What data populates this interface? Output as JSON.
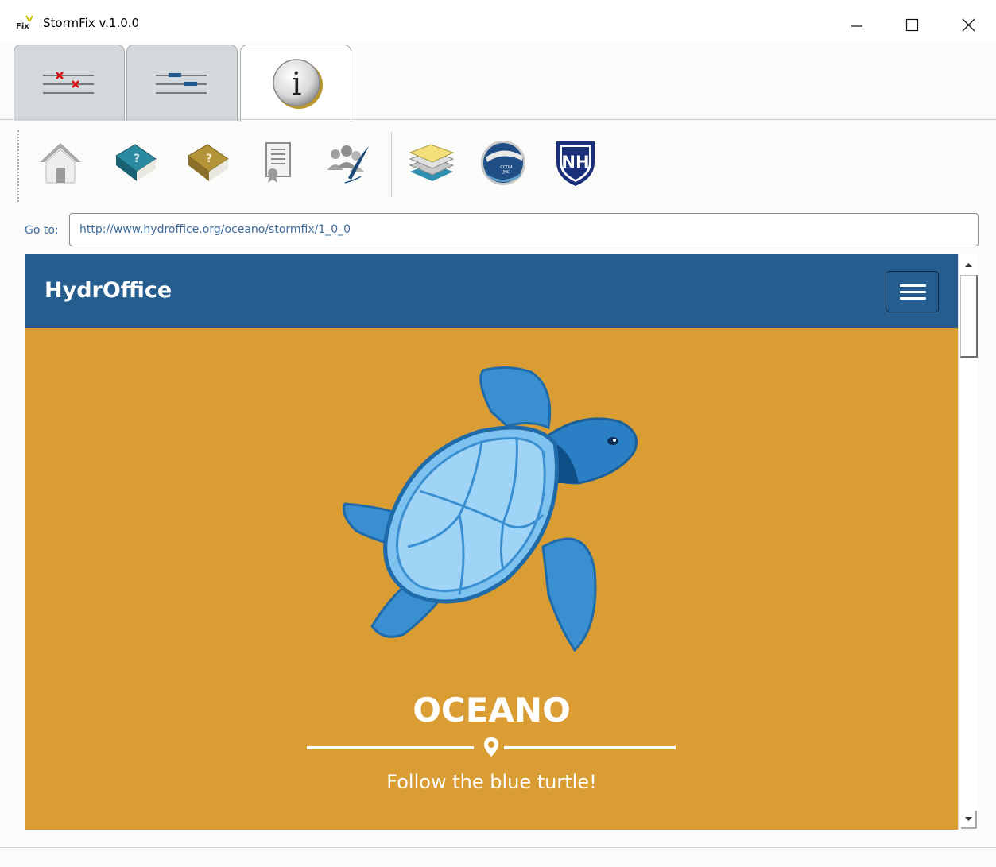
{
  "window": {
    "title": "StormFix v.1.0.0",
    "logo_text": "Fix",
    "controls": [
      "minimize",
      "maximize",
      "close"
    ]
  },
  "tabs": [
    {
      "icon": "lines-with-red-x-icon",
      "active": false
    },
    {
      "icon": "lines-with-blue-marks-icon",
      "active": false
    },
    {
      "icon": "info-icon",
      "active": true
    }
  ],
  "toolbar": {
    "items": [
      {
        "icon": "home-icon"
      },
      {
        "icon": "manual-book-blue-icon"
      },
      {
        "icon": "manual-book-gold-icon"
      },
      {
        "icon": "license-certificate-icon"
      },
      {
        "icon": "authors-quill-icon"
      },
      {
        "icon": "hydroffice-layers-icon"
      },
      {
        "icon": "ccom-jhc-logo-icon"
      },
      {
        "icon": "unh-logo-icon"
      }
    ]
  },
  "goto": {
    "label": "Go to:",
    "value": "http://www.hydroffice.org/oceano/stormfix/1_0_0"
  },
  "site": {
    "brand": "HydrOffice",
    "heading": "OCEANO",
    "subheading": "Follow the blue turtle!",
    "colors": {
      "nav": "#255d8f",
      "masthead": "#d99d34",
      "turtle": "#7ec3f0"
    }
  }
}
